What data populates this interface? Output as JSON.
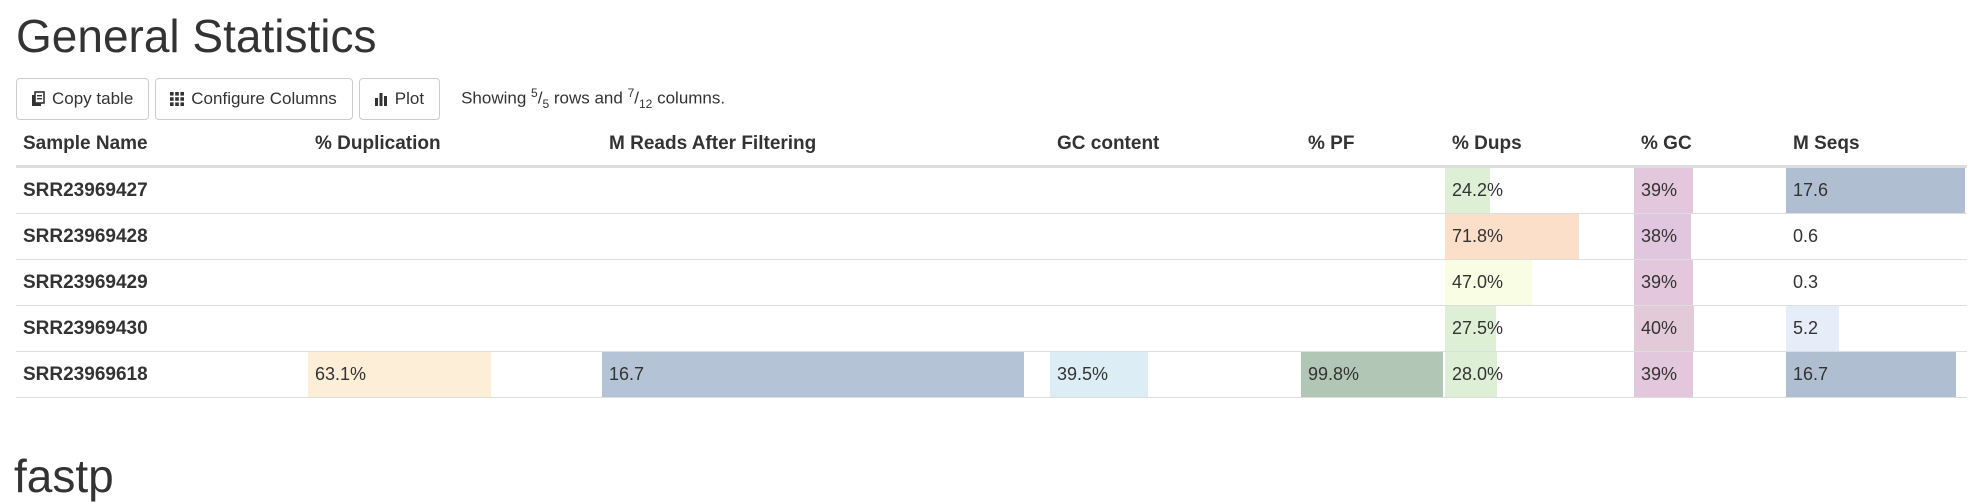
{
  "page": {
    "title": "General Statistics",
    "next_section_title": "fastp"
  },
  "toolbar": {
    "copy_label": "Copy table",
    "configure_label": "Configure Columns",
    "plot_label": "Plot",
    "showing_prefix": "Showing ",
    "rows_shown": "5",
    "rows_total": "5",
    "rows_word": " rows and ",
    "cols_shown": "7",
    "cols_total": "12",
    "cols_word": " columns."
  },
  "table": {
    "headers": [
      "Sample Name",
      "% Duplication",
      "M Reads After Filtering",
      "GC content",
      "% PF",
      "% Dups",
      "% GC",
      "M Seqs"
    ],
    "rows": [
      {
        "sample": "SRR23969427",
        "dup": "",
        "reads": "",
        "gc": "",
        "pf": "",
        "dups": "24.2%",
        "pgc": "39%",
        "mseqs": "17.6"
      },
      {
        "sample": "SRR23969428",
        "dup": "",
        "reads": "",
        "gc": "",
        "pf": "",
        "dups": "71.8%",
        "pgc": "38%",
        "mseqs": "0.6"
      },
      {
        "sample": "SRR23969429",
        "dup": "",
        "reads": "",
        "gc": "",
        "pf": "",
        "dups": "47.0%",
        "pgc": "39%",
        "mseqs": "0.3"
      },
      {
        "sample": "SRR23969430",
        "dup": "",
        "reads": "",
        "gc": "",
        "pf": "",
        "dups": "27.5%",
        "pgc": "40%",
        "mseqs": "5.2"
      },
      {
        "sample": "SRR23969618",
        "dup": "63.1%",
        "reads": "16.7",
        "gc": "39.5%",
        "pf": "99.8%",
        "dups": "28.0%",
        "pgc": "39%",
        "mseqs": "16.7"
      }
    ],
    "bar_levels": {
      "dup": [
        0,
        0,
        0,
        0,
        0.631
      ],
      "reads": [
        0,
        0,
        0,
        0,
        0.95
      ],
      "gc": [
        0,
        0,
        0,
        0,
        0.395
      ],
      "pf": [
        0,
        0,
        0,
        0,
        0.998
      ],
      "dups": [
        0.242,
        0.718,
        0.47,
        0.275,
        0.28
      ],
      "pgc": [
        0.39,
        0.38,
        0.39,
        0.4,
        0.39
      ],
      "mseqs": [
        1.0,
        0.034,
        0.017,
        0.295,
        0.949
      ]
    },
    "colors": {
      "dup": "#fdefd7",
      "reads": "#b4c3d6",
      "gc": "#ddedf5",
      "pf": "#b1c6b4",
      "dups": [
        "#ddf0d6",
        "#fcdfc9",
        "#f9fde3",
        "#ddf0d6",
        "#ddf0d6"
      ],
      "pgc": [
        "#e3c7dc",
        "#e0c6de",
        "#e3c7dc",
        "#e2cad9",
        "#e3c7dc"
      ],
      "mseqs": [
        "#b0bed1",
        "#ffffff",
        "#ffffff",
        "#e5eef8",
        "#b0bed1"
      ]
    }
  }
}
